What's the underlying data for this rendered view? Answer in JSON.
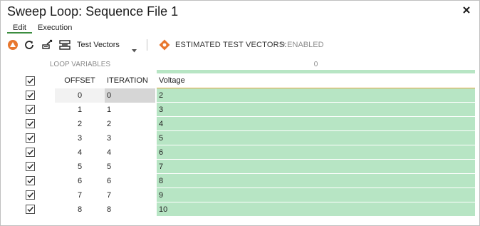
{
  "window": {
    "title": "Sweep Loop: Sequence File 1",
    "close_icon": "close-icon"
  },
  "menu": {
    "items": [
      {
        "label": "Edit",
        "active": true
      },
      {
        "label": "Execution",
        "active": false
      }
    ]
  },
  "toolbar": {
    "icons": [
      "stop-icon",
      "refresh-icon",
      "edit-vectors-icon"
    ],
    "dropdown_label": "Test Vectors",
    "estimate_label": "ESTIMATED TEST VECTORS:",
    "estimate_value": "9 ENABLED",
    "accent_orange": "#e8772e"
  },
  "grid": {
    "group_header_left": "LOOP VARIABLES",
    "group_header_right": "0",
    "columns": {
      "offset": "OFFSET",
      "iteration": "ITERATION",
      "voltage": "Voltage"
    },
    "rows": [
      {
        "checked": true,
        "offset": "0",
        "iteration": "0",
        "voltage": "2"
      },
      {
        "checked": true,
        "offset": "1",
        "iteration": "1",
        "voltage": "3"
      },
      {
        "checked": true,
        "offset": "2",
        "iteration": "2",
        "voltage": "4"
      },
      {
        "checked": true,
        "offset": "3",
        "iteration": "3",
        "voltage": "5"
      },
      {
        "checked": true,
        "offset": "4",
        "iteration": "4",
        "voltage": "6"
      },
      {
        "checked": true,
        "offset": "5",
        "iteration": "5",
        "voltage": "7"
      },
      {
        "checked": true,
        "offset": "6",
        "iteration": "6",
        "voltage": "8"
      },
      {
        "checked": true,
        "offset": "7",
        "iteration": "7",
        "voltage": "9"
      },
      {
        "checked": true,
        "offset": "8",
        "iteration": "8",
        "voltage": "10"
      }
    ],
    "value_fill_color": "#b7e5c4"
  }
}
